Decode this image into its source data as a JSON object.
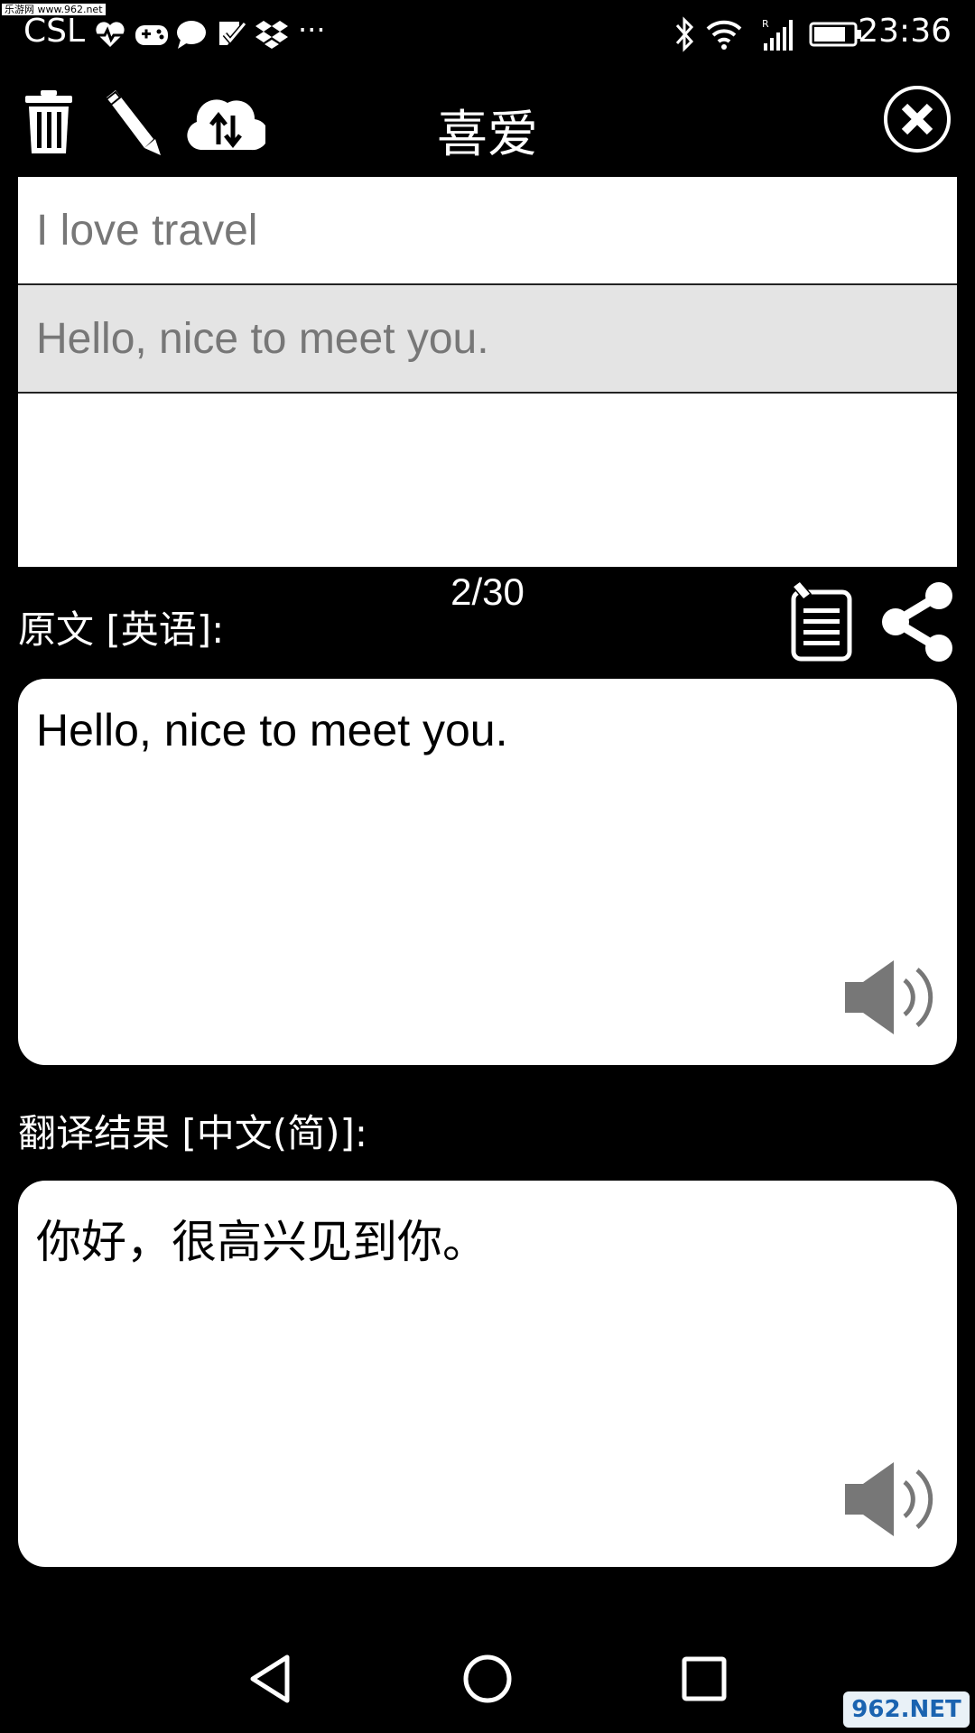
{
  "status_bar": {
    "carrier": "CSL",
    "time": "23:36",
    "more": "···",
    "watermark": "乐游网 www.962.net"
  },
  "toolbar": {
    "title": "喜爱"
  },
  "history": {
    "items": [
      {
        "text": "I love travel",
        "selected": false
      },
      {
        "text": "Hello, nice to meet you.",
        "selected": true
      }
    ]
  },
  "source": {
    "counter": "2/30",
    "label": "原文 [英语]:",
    "text": "Hello, nice to meet you."
  },
  "result": {
    "label": "翻译结果 [中文(简)]:",
    "text": "你好，很高兴见到你。"
  },
  "badge": {
    "text": "962.NET"
  },
  "colors": {
    "background": "#000000",
    "panel": "#ffffff",
    "selected_row": "#e4e4e4",
    "muted_text": "#777777",
    "icon": "#ffffff",
    "speaker": "#777777"
  }
}
